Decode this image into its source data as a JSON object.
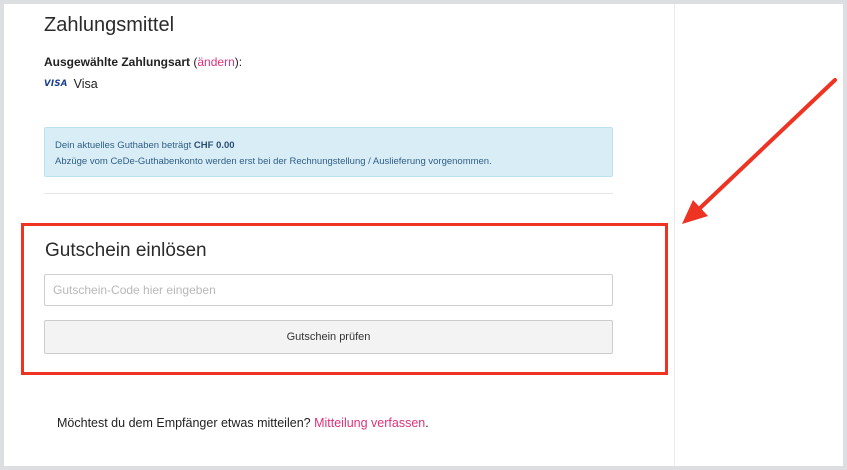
{
  "payment": {
    "title": "Zahlungsmittel",
    "selected_label": "Ausgewählte Zahlungsart",
    "paren_open": " (",
    "change_link": "ändern",
    "paren_close": "):",
    "card_logo": "VISA",
    "card_name": "Visa"
  },
  "info": {
    "line1_prefix": "Dein aktuelles Guthaben beträgt ",
    "balance": "CHF 0.00",
    "line2": "Abzüge vom CeDe-Guthabenkonto werden erst bei der Rechnungstellung / Auslieferung vorgenommen."
  },
  "voucher": {
    "title": "Gutschein einlösen",
    "placeholder": "Gutschein-Code hier eingeben",
    "value": "",
    "button_label": "Gutschein prüfen"
  },
  "message": {
    "text": "Möchtest du dem Empfänger etwas mitteilen? ",
    "link": "Mitteilung verfassen",
    "suffix": "."
  },
  "colors": {
    "accent_link": "#e0317a",
    "annotation_red": "#ee3322",
    "info_bg": "#d9edf7"
  }
}
